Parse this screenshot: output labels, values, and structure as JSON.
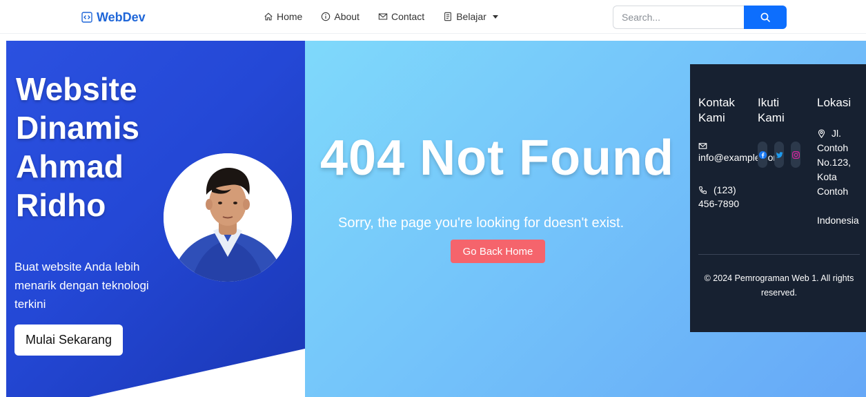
{
  "navbar": {
    "brand": "WebDev",
    "links": [
      {
        "label": "Home",
        "icon": "home-icon"
      },
      {
        "label": "About",
        "icon": "info-icon"
      },
      {
        "label": "Contact",
        "icon": "envelope-icon"
      },
      {
        "label": "Belajar",
        "icon": "journal-icon",
        "dropdown": true
      }
    ],
    "search_placeholder": "Search...",
    "search_icon": "search-icon"
  },
  "hero": {
    "title_lines": [
      "Website",
      "Dinamis",
      "Ahmad",
      "Ridho"
    ],
    "subtitle": "Buat website Anda lebih menarik dengan teknologi terkini",
    "cta_label": "Mulai Sekarang"
  },
  "error": {
    "title": "404 Not Found",
    "message": "Sorry, the page you're looking for doesn't exist.",
    "button_label": "Go Back Home"
  },
  "footer": {
    "contact_heading": "Kontak Kami",
    "email": "info@example.com",
    "phone": "(123) 456-7890",
    "follow_heading": "Ikuti Kami",
    "social": [
      "facebook-icon",
      "twitter-icon",
      "instagram-icon"
    ],
    "location_heading": "Lokasi",
    "address": "Jl. Contoh No.123, Kota Contoh",
    "country": "Indonesia",
    "copyright": "© 2024 Pemrograman Web 1. All rights reserved."
  },
  "colors": {
    "brand": "#1f66d8",
    "primary_button": "#0d6efd",
    "hero_bg": "#2448d6",
    "error_button": "#f5646c",
    "footer_bg": "#172131"
  }
}
